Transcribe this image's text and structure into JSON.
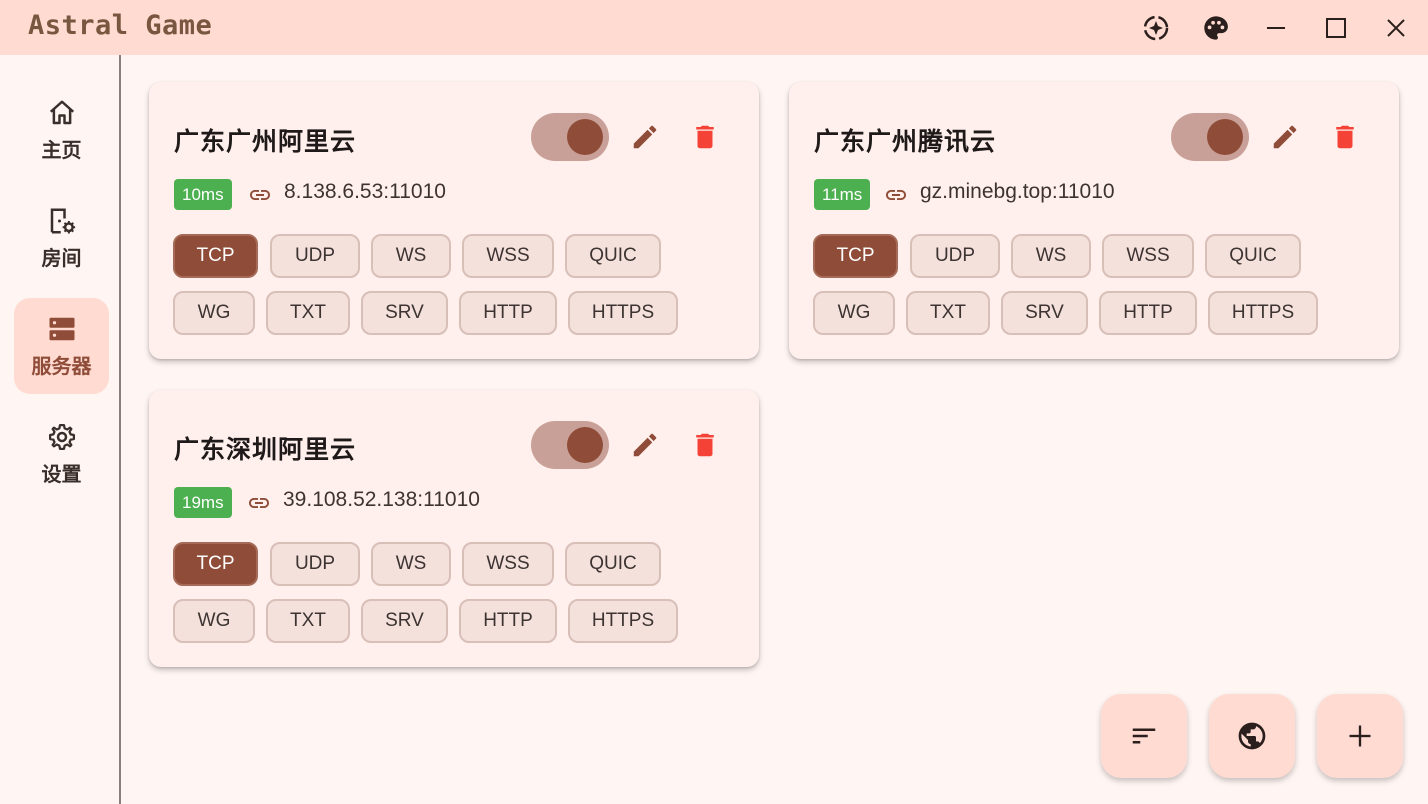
{
  "window": {
    "title": "Astral Game",
    "controls": [
      "help-sparkle-icon",
      "palette-icon",
      "minimize-icon",
      "maximize-icon",
      "close-icon"
    ]
  },
  "colors": {
    "titlebar": "#ffdbd1",
    "background": "#fff5f3",
    "accent": "#8f4c38",
    "latency_good": "#4caf50",
    "delete": "#f44336"
  },
  "sidebar": {
    "items": [
      {
        "label": "主页",
        "icon": "home-icon",
        "active": false
      },
      {
        "label": "房间",
        "icon": "room-settings-icon",
        "active": false
      },
      {
        "label": "服务器",
        "icon": "server-icon",
        "active": true
      },
      {
        "label": "设置",
        "icon": "gear-icon",
        "active": false
      }
    ]
  },
  "servers": [
    {
      "name": "广东广州阿里云",
      "enabled": true,
      "latency": "10ms",
      "address": "8.138.6.53:11010",
      "protocols_row1": [
        "TCP",
        "UDP",
        "WS",
        "WSS",
        "QUIC"
      ],
      "protocols_row2": [
        "WG",
        "TXT",
        "SRV",
        "HTTP",
        "HTTPS"
      ],
      "selected_protocol": "TCP"
    },
    {
      "name": "广东广州腾讯云",
      "enabled": true,
      "latency": "11ms",
      "address": "gz.minebg.top:11010",
      "protocols_row1": [
        "TCP",
        "UDP",
        "WS",
        "WSS",
        "QUIC"
      ],
      "protocols_row2": [
        "WG",
        "TXT",
        "SRV",
        "HTTP",
        "HTTPS"
      ],
      "selected_protocol": "TCP"
    },
    {
      "name": "广东深圳阿里云",
      "enabled": true,
      "latency": "19ms",
      "address": "39.108.52.138:11010",
      "protocols_row1": [
        "TCP",
        "UDP",
        "WS",
        "WSS",
        "QUIC"
      ],
      "protocols_row2": [
        "WG",
        "TXT",
        "SRV",
        "HTTP",
        "HTTPS"
      ],
      "selected_protocol": "TCP"
    }
  ],
  "fabs": [
    "sort-icon",
    "globe-icon",
    "add-icon"
  ]
}
